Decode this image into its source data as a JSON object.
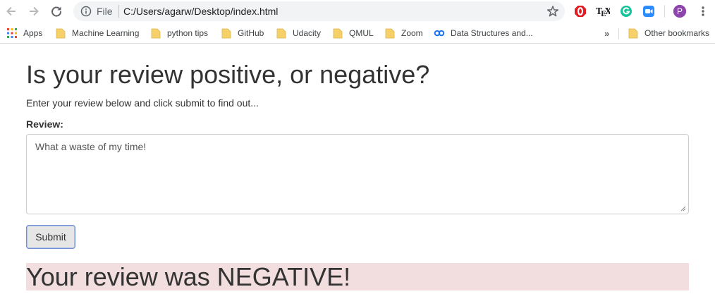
{
  "browser": {
    "scheme_label": "File",
    "url": "C:/Users/agarw/Desktop/index.html",
    "profile_initial": "P",
    "colors": {
      "omnibox_bg": "#f1f3f4",
      "profile": "#8e44ad",
      "folder": "#f6d16a"
    }
  },
  "bookmarks": {
    "apps_label": "Apps",
    "items": [
      {
        "label": "Machine Learning",
        "icon": "folder-icon"
      },
      {
        "label": "python tips",
        "icon": "folder-icon"
      },
      {
        "label": "GitHub",
        "icon": "folder-icon"
      },
      {
        "label": "Udacity",
        "icon": "folder-icon"
      },
      {
        "label": "QMUL",
        "icon": "folder-icon"
      },
      {
        "label": "Zoom",
        "icon": "folder-icon"
      },
      {
        "label": "Data Structures and...",
        "icon": "link-icon"
      }
    ],
    "overflow_label": "»",
    "other_label": "Other bookmarks"
  },
  "page": {
    "heading": "Is your review positive, or negative?",
    "subtitle": "Enter your review below and click submit to find out...",
    "review_label": "Review:",
    "review_text": "What a waste of my time!",
    "submit_label": "Submit",
    "result_text": "Your review was NEGATIVE!",
    "colors": {
      "result_bg": "#f2dede",
      "text": "#333333"
    }
  }
}
